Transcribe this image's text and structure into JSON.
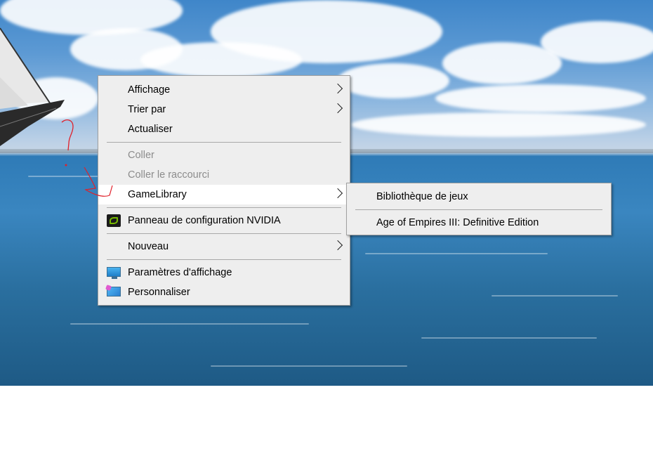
{
  "main_menu": {
    "items": [
      {
        "label": "Affichage",
        "submenu": true,
        "disabled": false
      },
      {
        "label": "Trier par",
        "submenu": true,
        "disabled": false
      },
      {
        "label": "Actualiser",
        "submenu": false,
        "disabled": false
      },
      {
        "label": "Coller",
        "submenu": false,
        "disabled": true
      },
      {
        "label": "Coller le raccourci",
        "submenu": false,
        "disabled": true
      },
      {
        "label": "GameLibrary",
        "submenu": true,
        "disabled": false,
        "hovered": true
      },
      {
        "label": "Panneau de configuration NVIDIA",
        "submenu": false,
        "icon": "nvidia-icon"
      },
      {
        "label": "Nouveau",
        "submenu": true,
        "disabled": false
      },
      {
        "label": "Paramètres d'affichage",
        "submenu": false,
        "icon": "display-settings-icon"
      },
      {
        "label": "Personnaliser",
        "submenu": false,
        "icon": "personalize-icon"
      }
    ]
  },
  "sub_menu": {
    "items": [
      {
        "label": "Bibliothèque de jeux"
      },
      {
        "label": "Age of Empires III: Definitive Edition"
      }
    ]
  },
  "colors": {
    "menu_bg": "#eeeeee",
    "menu_border": "#a0a0a0",
    "disabled_text": "#8c8c8c",
    "annotation_red": "#e0202a"
  }
}
